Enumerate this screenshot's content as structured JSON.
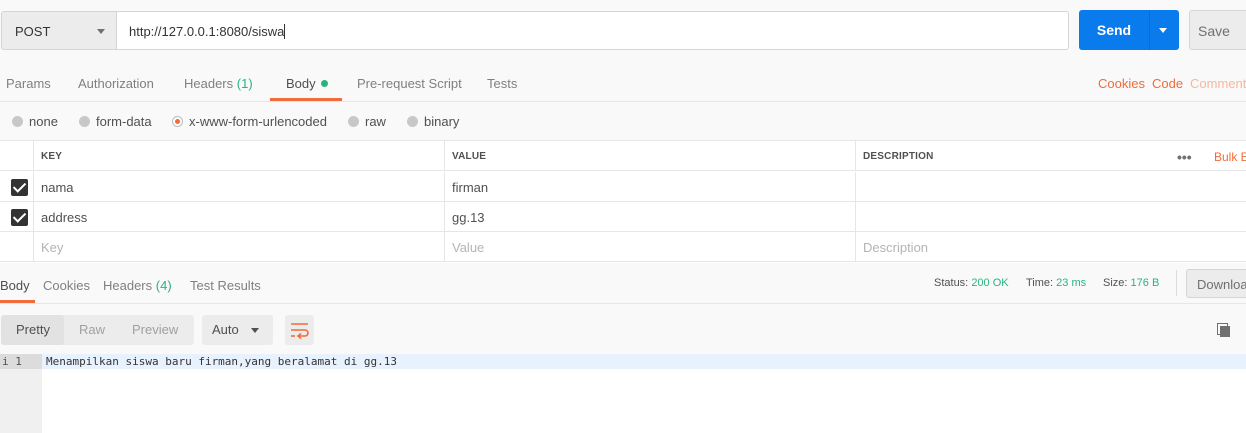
{
  "request": {
    "method": "POST",
    "url": "http://127.0.0.1:8080/siswa",
    "send_label": "Send",
    "save_label": "Save"
  },
  "request_tabs": {
    "params": "Params",
    "authorization": "Authorization",
    "headers": "Headers",
    "headers_count": "(1)",
    "body": "Body",
    "prerequest": "Pre-request Script",
    "tests": "Tests",
    "cookies": "Cookies",
    "code": "Code",
    "comments": "Comment"
  },
  "body_types": {
    "none": "none",
    "form_data": "form-data",
    "urlencoded": "x-www-form-urlencoded",
    "raw": "raw",
    "binary": "binary",
    "selected": "x-www-form-urlencoded"
  },
  "params_table": {
    "headers": {
      "key": "KEY",
      "value": "VALUE",
      "description": "DESCRIPTION",
      "bulk_edit": "Bulk E"
    },
    "rows": [
      {
        "key": "nama",
        "value": "firman",
        "description": "",
        "checked": true
      },
      {
        "key": "address",
        "value": "gg.13",
        "description": "",
        "checked": true
      }
    ],
    "placeholders": {
      "key": "Key",
      "value": "Value",
      "description": "Description"
    }
  },
  "response_tabs": {
    "body": "Body",
    "cookies": "Cookies",
    "headers": "Headers",
    "headers_count": "(4)",
    "test_results": "Test Results"
  },
  "response_status": {
    "status_label": "Status:",
    "status_value": "200 OK",
    "time_label": "Time:",
    "time_value": "23 ms",
    "size_label": "Size:",
    "size_value": "176 B",
    "download_label": "Downloa"
  },
  "response_toolbar": {
    "pretty": "Pretty",
    "raw": "Raw",
    "preview": "Preview",
    "format": "Auto"
  },
  "response_body": {
    "line_number": "1",
    "fold_marker": "i",
    "content": "Menampilkan siswa baru firman,yang beralamat di gg.13"
  },
  "colors": {
    "accent": "#f26b3a",
    "send_blue": "#097bed",
    "success_green": "#26b47f"
  }
}
